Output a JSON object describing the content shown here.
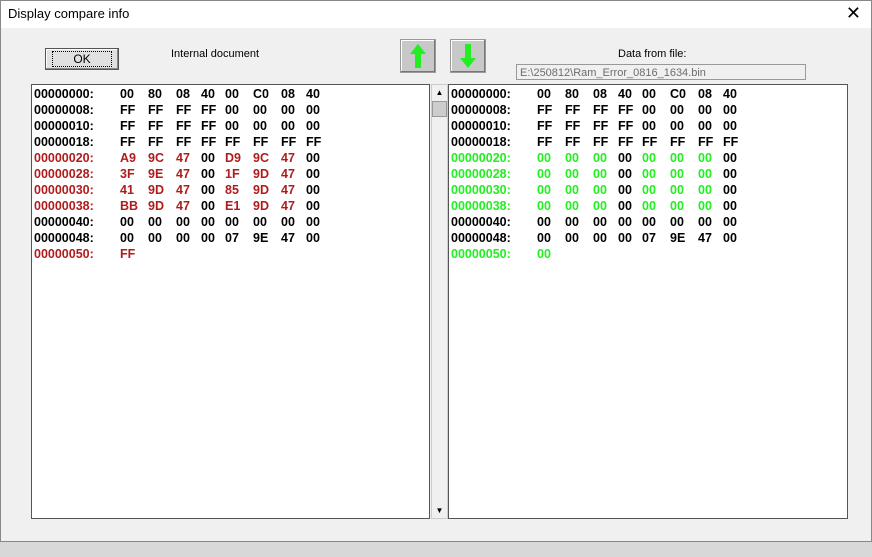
{
  "window": {
    "title": "Display compare info",
    "close": "✕"
  },
  "ok_label": "OK",
  "left_label": "Internal document",
  "right_label": "Data from file:",
  "file_path": "E:\\250812\\Ram_Error_0816_1634.bin",
  "colors": {
    "normal": "#000000",
    "left_diff": "#b01c1c",
    "right_diff": "#22ee22",
    "arrow": "#22ee22"
  },
  "left_rows": [
    {
      "addr": "00000000:",
      "bytes": [
        "00",
        "80",
        "08",
        "40",
        "00",
        "C0",
        "08",
        "40"
      ],
      "diff": []
    },
    {
      "addr": "00000008:",
      "bytes": [
        "FF",
        "FF",
        "FF",
        "FF",
        "00",
        "00",
        "00",
        "00"
      ],
      "diff": []
    },
    {
      "addr": "00000010:",
      "bytes": [
        "FF",
        "FF",
        "FF",
        "FF",
        "00",
        "00",
        "00",
        "00"
      ],
      "diff": []
    },
    {
      "addr": "00000018:",
      "bytes": [
        "FF",
        "FF",
        "FF",
        "FF",
        "FF",
        "FF",
        "FF",
        "FF"
      ],
      "diff": []
    },
    {
      "addr": "00000020:",
      "bytes": [
        "A9",
        "9C",
        "47",
        "00",
        "D9",
        "9C",
        "47",
        "00"
      ],
      "diff": [
        0,
        1,
        2,
        4,
        5,
        6
      ]
    },
    {
      "addr": "00000028:",
      "bytes": [
        "3F",
        "9E",
        "47",
        "00",
        "1F",
        "9D",
        "47",
        "00"
      ],
      "diff": [
        0,
        1,
        2,
        4,
        5,
        6
      ]
    },
    {
      "addr": "00000030:",
      "bytes": [
        "41",
        "9D",
        "47",
        "00",
        "85",
        "9D",
        "47",
        "00"
      ],
      "diff": [
        0,
        1,
        2,
        4,
        5,
        6
      ]
    },
    {
      "addr": "00000038:",
      "bytes": [
        "BB",
        "9D",
        "47",
        "00",
        "E1",
        "9D",
        "47",
        "00"
      ],
      "diff": [
        0,
        1,
        2,
        4,
        5,
        6
      ]
    },
    {
      "addr": "00000040:",
      "bytes": [
        "00",
        "00",
        "00",
        "00",
        "00",
        "00",
        "00",
        "00"
      ],
      "diff": []
    },
    {
      "addr": "00000048:",
      "bytes": [
        "00",
        "00",
        "00",
        "00",
        "07",
        "9E",
        "47",
        "00"
      ],
      "diff": []
    },
    {
      "addr": "00000050:",
      "bytes": [
        "FF"
      ],
      "diff": [
        0
      ]
    }
  ],
  "right_rows": [
    {
      "addr": "00000000:",
      "bytes": [
        "00",
        "80",
        "08",
        "40",
        "00",
        "C0",
        "08",
        "40"
      ],
      "diff": []
    },
    {
      "addr": "00000008:",
      "bytes": [
        "FF",
        "FF",
        "FF",
        "FF",
        "00",
        "00",
        "00",
        "00"
      ],
      "diff": []
    },
    {
      "addr": "00000010:",
      "bytes": [
        "FF",
        "FF",
        "FF",
        "FF",
        "00",
        "00",
        "00",
        "00"
      ],
      "diff": []
    },
    {
      "addr": "00000018:",
      "bytes": [
        "FF",
        "FF",
        "FF",
        "FF",
        "FF",
        "FF",
        "FF",
        "FF"
      ],
      "diff": []
    },
    {
      "addr": "00000020:",
      "bytes": [
        "00",
        "00",
        "00",
        "00",
        "00",
        "00",
        "00",
        "00"
      ],
      "diff": [
        0,
        1,
        2,
        4,
        5,
        6
      ]
    },
    {
      "addr": "00000028:",
      "bytes": [
        "00",
        "00",
        "00",
        "00",
        "00",
        "00",
        "00",
        "00"
      ],
      "diff": [
        0,
        1,
        2,
        4,
        5,
        6
      ]
    },
    {
      "addr": "00000030:",
      "bytes": [
        "00",
        "00",
        "00",
        "00",
        "00",
        "00",
        "00",
        "00"
      ],
      "diff": [
        0,
        1,
        2,
        4,
        5,
        6
      ]
    },
    {
      "addr": "00000038:",
      "bytes": [
        "00",
        "00",
        "00",
        "00",
        "00",
        "00",
        "00",
        "00"
      ],
      "diff": [
        0,
        1,
        2,
        4,
        5,
        6
      ]
    },
    {
      "addr": "00000040:",
      "bytes": [
        "00",
        "00",
        "00",
        "00",
        "00",
        "00",
        "00",
        "00"
      ],
      "diff": []
    },
    {
      "addr": "00000048:",
      "bytes": [
        "00",
        "00",
        "00",
        "00",
        "07",
        "9E",
        "47",
        "00"
      ],
      "diff": []
    },
    {
      "addr": "00000050:",
      "bytes": [
        "00"
      ],
      "diff": [
        0
      ]
    }
  ]
}
